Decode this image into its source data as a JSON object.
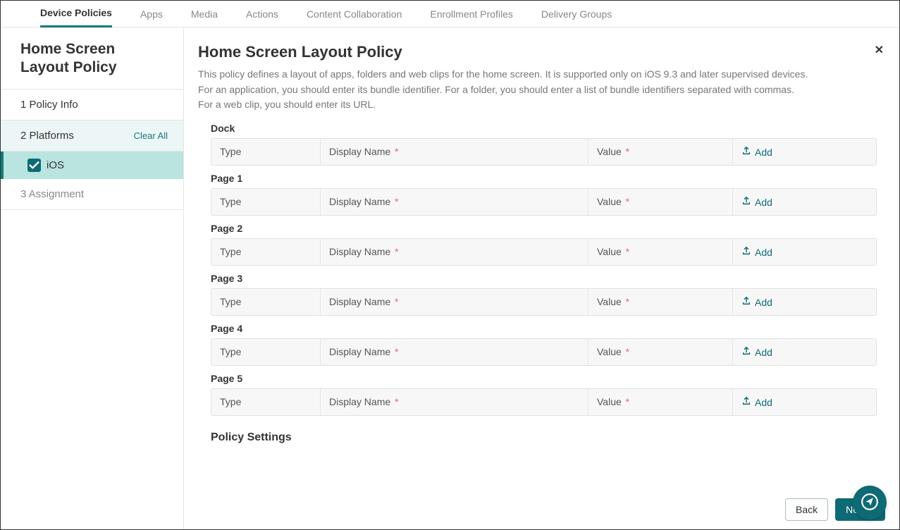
{
  "tabs": {
    "device_policies": "Device Policies",
    "apps": "Apps",
    "media": "Media",
    "actions": "Actions",
    "content_collab": "Content Collaboration",
    "enrollment": "Enrollment Profiles",
    "delivery": "Delivery Groups"
  },
  "sidebar": {
    "title": "Home Screen Layout Policy",
    "step1": "1  Policy Info",
    "step2": "2  Platforms",
    "clear_all": "Clear All",
    "ios": "iOS",
    "step3": "3  Assignment"
  },
  "main": {
    "heading": "Home Screen Layout Policy",
    "desc_line1": "This policy defines a layout of apps, folders and web clips for the home screen. It is supported only on iOS 9.3 and later supervised devices.",
    "desc_line2": "For an application, you should enter its bundle identifier. For a folder, you should enter a list of bundle identifiers separated with commas.",
    "desc_line3": "For a web clip, you should enter its URL.",
    "policy_settings": "Policy Settings"
  },
  "cols": {
    "type": "Type",
    "display_name": "Display Name",
    "value": "Value",
    "add": "Add",
    "asterisk": "*"
  },
  "sections": [
    "Dock",
    "Page 1",
    "Page 2",
    "Page 3",
    "Page 4",
    "Page 5"
  ],
  "buttons": {
    "back": "Back",
    "next": "Next >"
  }
}
